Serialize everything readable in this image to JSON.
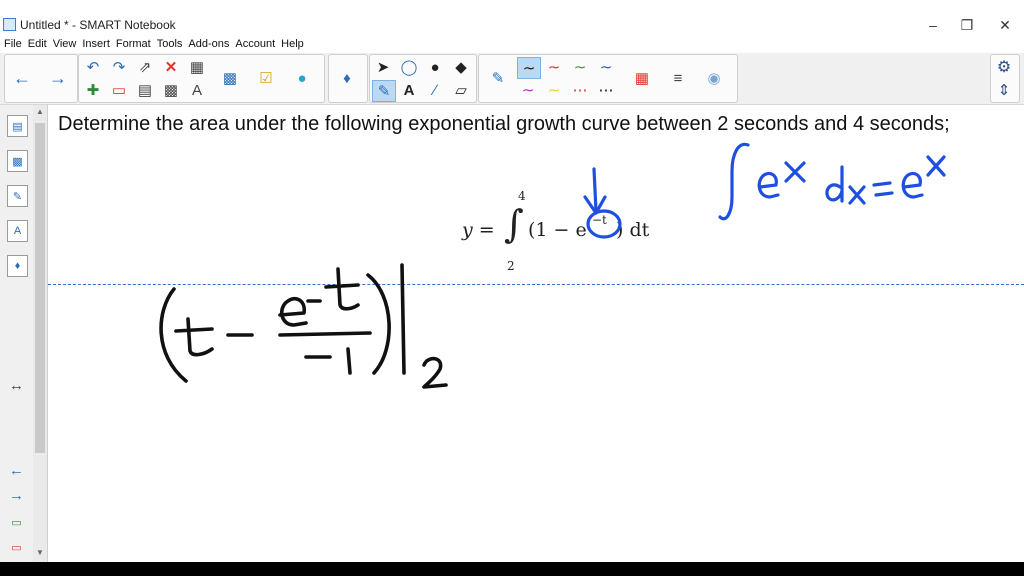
{
  "window": {
    "title": "Untitled * - SMART Notebook"
  },
  "menu": [
    "File",
    "Edit",
    "View",
    "Insert",
    "Format",
    "Tools",
    "Add-ons",
    "Account",
    "Help"
  ],
  "question": "Determine the area under the following exponential growth curve between 2 seconds and 4 seconds;",
  "formula": {
    "lhs": "y =",
    "upper": "4",
    "lower": "2",
    "integrand": "(1 − e",
    "exponent": "−t",
    "tail": ") dt"
  },
  "handwriting": {
    "color_blue": "#1f4fe0",
    "color_black": "#111111"
  }
}
